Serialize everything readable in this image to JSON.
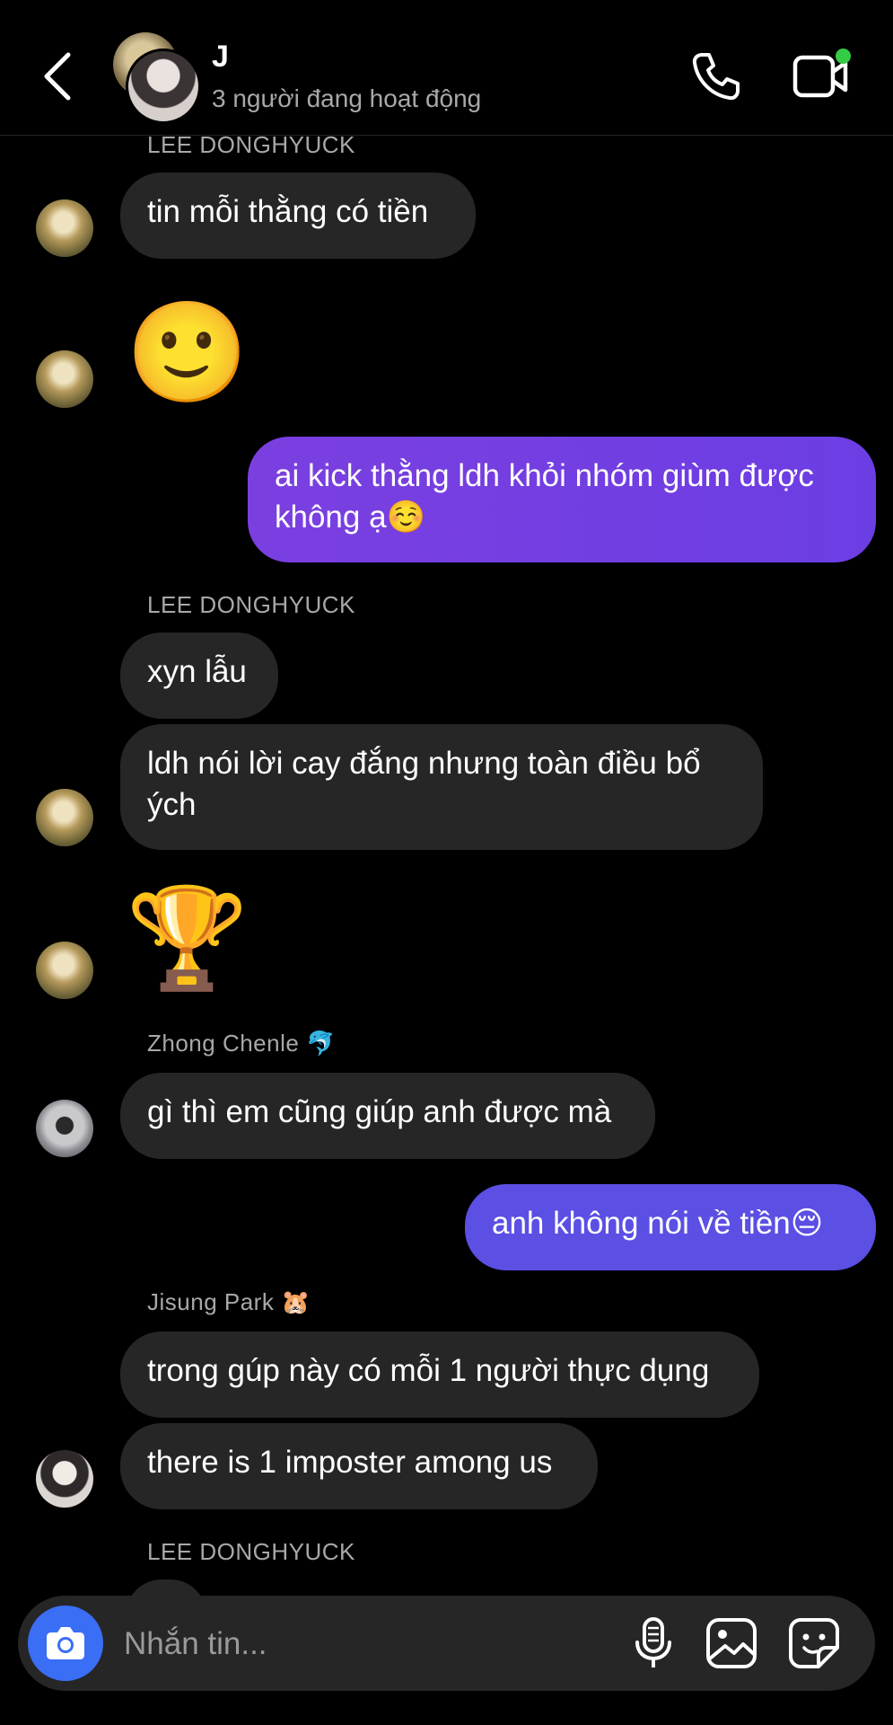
{
  "header": {
    "title": "J",
    "subtitle": "3 người đang hoạt động",
    "back_icon": "chevron-left-icon",
    "call_icon": "phone-icon",
    "video_icon": "video-camera-icon",
    "online_color": "#33cc44"
  },
  "colors": {
    "outgoing_1": "#7b3fe0",
    "outgoing_2": "#5b4fe4",
    "incoming": "#262626",
    "accent_camera": "#3a6ef5"
  },
  "messages": {
    "name_top": "LEE DONGHYUCK",
    "m1": "tin mỗi thằng có tiền",
    "m2_emoji": "🙂",
    "m3_line1": "ai kick thằng ldh khỏi nhóm giùm được",
    "m3_line2": "không ạ☺️",
    "name_ldh2": "LEE DONGHYUCK",
    "m4": "xyn lẫu",
    "m5_line1": "ldh nói lời cay đắng nhưng toàn điều bổ",
    "m5_line2": "ých",
    "m6_emoji": "🏆",
    "name_chenle": "Zhong Chenle",
    "name_chenle_emoji": "🐬",
    "m7": "gì thì em cũng giúp anh được mà",
    "m8": "anh không nói về tiền😔",
    "name_jisung": "Jisung Park",
    "name_jisung_emoji": "🐹",
    "m9": "trong gúp này có mỗi 1 người thực dụng",
    "m10": "there is 1 imposter among us",
    "name_ldh3": "LEE DONGHYUCK"
  },
  "composer": {
    "placeholder": "Nhắn tin...",
    "camera_icon": "camera-icon",
    "mic_icon": "microphone-icon",
    "image_icon": "image-icon",
    "sticker_icon": "sticker-icon"
  }
}
